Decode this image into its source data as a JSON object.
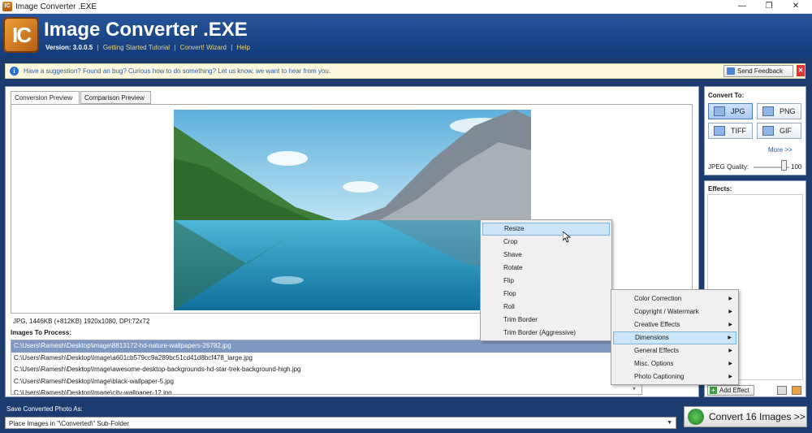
{
  "window": {
    "title": "Image Converter .EXE",
    "minimize": "—",
    "maximize": "❐",
    "close": "✕"
  },
  "header": {
    "logo": "IC",
    "title": "Image Converter .EXE",
    "version": "Version: 3.0.0.5",
    "links": [
      "Getting Started Tutorial",
      "Convert! Wizard",
      "Help"
    ]
  },
  "feedback": {
    "message": "Have a suggestion? Found an bug? Curious how to do something? Let us know, we want to hear from you.",
    "button": "Send Feedback",
    "close": "✕"
  },
  "tabs": [
    "Conversion Preview",
    "Comparison Preview"
  ],
  "preview": {
    "info": "JPG, 1446KB (+812KB) 1920x1080, DPI:72x72"
  },
  "images_to_process": {
    "label": "Images To Process:",
    "files": [
      "C:\\Users\\Ramesh\\Desktop\\image\\8813172-hd-nature-wallpapers-26782.jpg",
      "C:\\Users\\Ramesh\\Desktop\\Image\\a601cb579cc9a289bc51cd41d8bcf478_large.jpg",
      "C:\\Users\\Ramesh\\Desktop\\Image\\awesome-desktop-backgrounds-hd-star-trek-background-high.jpg",
      "C:\\Users\\Ramesh\\Desktop\\Image\\black-wallpaper-5.jpg",
      "C:\\Users\\Ramesh\\Desktop\\Image\\city-wallpaper-12.jpg"
    ],
    "selected_index": 0
  },
  "convert_to": {
    "label": "Convert To:",
    "formats": [
      "JPG",
      "PNG",
      "TIFF",
      "GIF"
    ],
    "selected": "JPG",
    "more": "More >>",
    "jpeg_quality_label": "JPEG Quality:",
    "jpeg_quality": "100"
  },
  "effects": {
    "label": "Effects:",
    "add_button": "Add Effect"
  },
  "context_menu": {
    "main": [
      "Color Correction",
      "Copyright / Watermark",
      "Creative Effects",
      "Dimensions",
      "General Effects",
      "Misc. Options",
      "Photo Captioning"
    ],
    "main_highlighted": "Dimensions",
    "sub": [
      "Resize",
      "Crop",
      "Shave",
      "Rotate",
      "Flip",
      "Flop",
      "Roll",
      "Trim Border",
      "Trim Border (Aggressive)"
    ],
    "sub_highlighted": "Resize"
  },
  "bottom": {
    "save_label": "Save Converted Photo As:",
    "save_option": "Place Images in \"\\Converted\\\" Sub-Folder",
    "convert_button": "Convert 16 Images >>"
  }
}
